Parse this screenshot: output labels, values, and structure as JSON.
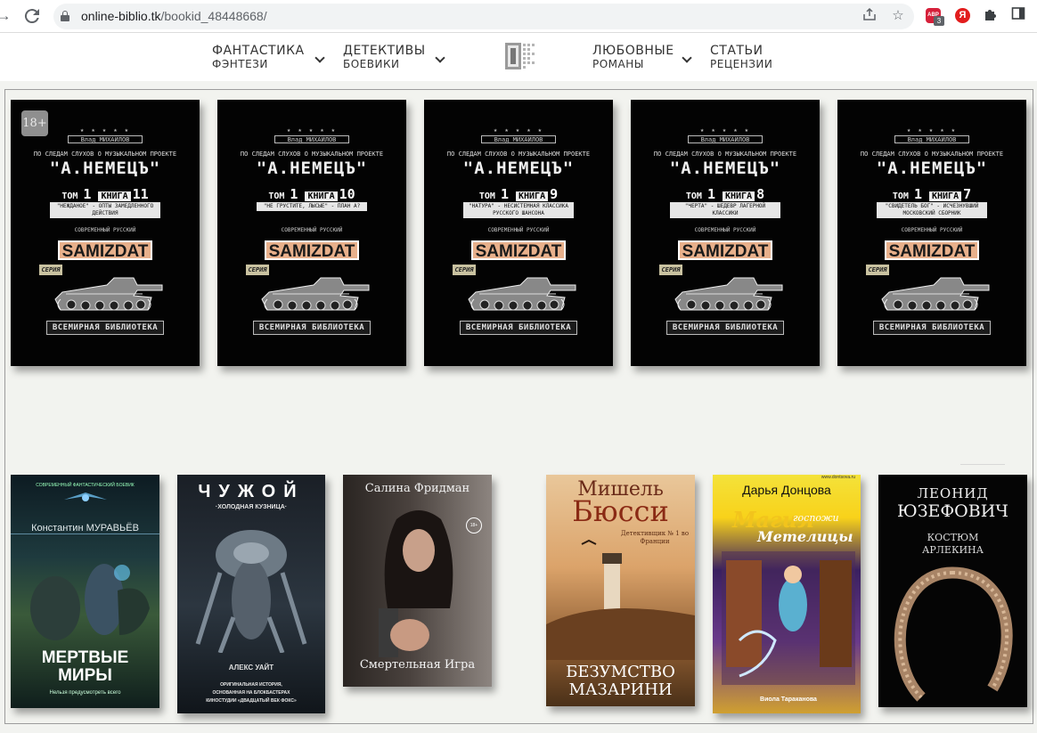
{
  "browser": {
    "back_icon": "arrow-right",
    "reload_icon": "reload",
    "url_host": "online-biblio.tk",
    "url_path": "/bookid_48448668/",
    "ext_abp_label": "ABP",
    "ext_abp_badge": "3",
    "ext_yandex_label": "Я"
  },
  "nav": {
    "items": [
      {
        "line1": "ФАНТАСТИКА",
        "line2": "ФЭНТЕЗИ",
        "has_dropdown": true
      },
      {
        "line1": "ДЕТЕКТИВЫ",
        "line2": "БОЕВИКИ",
        "has_dropdown": true
      },
      {
        "line1": "ЛЮБОВНЫЕ",
        "line2": "РОМАНЫ",
        "has_dropdown": true
      },
      {
        "line1": "СТАТЬИ",
        "line2": "РЕЦЕНЗИИ",
        "has_dropdown": false
      }
    ]
  },
  "series_books": [
    {
      "author": "Влад МИХАЙЛОВ",
      "project": "ПО СЛЕДАМ СЛУХОВ О МУЗЫКАЛЬНОМ ПРОЕКТЕ",
      "title": "\"А.НЕМЕЦЪ\"",
      "tom_word": "ТОМ",
      "tom": "1",
      "kniga_word": "КНИГА",
      "kniga": "11",
      "subtitle": "\"НЕЖДАНОЕ\" - ОПТЫ ЗАМЕДЛЕННОГО ДЕЙСТВИЯ",
      "sovremenny": "СОВРЕМЕННЫЙ РУССКИЙ",
      "logo": "SAMIZDAT",
      "seriya": "СЕРИЯ",
      "library": "ВСЕМИРНАЯ БИБЛИОТЕКА",
      "age": "18+"
    },
    {
      "author": "Влад МИХАЙЛОВ",
      "project": "ПО СЛЕДАМ СЛУХОВ О МУЗЫКАЛЬНОМ ПРОЕКТЕ",
      "title": "\"А.НЕМЕЦЪ\"",
      "tom_word": "ТОМ",
      "tom": "1",
      "kniga_word": "КНИГА",
      "kniga": "10",
      "subtitle": "\"НЕ ГРУСТИТЕ, ЛЫСЫЕ\" - ПЛАН А?",
      "sovremenny": "СОВРЕМЕННЫЙ РУССКИЙ",
      "logo": "SAMIZDAT",
      "seriya": "СЕРИЯ",
      "library": "ВСЕМИРНАЯ БИБЛИОТЕКА"
    },
    {
      "author": "Влад МИХАЙЛОВ",
      "project": "ПО СЛЕДАМ СЛУХОВ О МУЗЫКАЛЬНОМ ПРОЕКТЕ",
      "title": "\"А.НЕМЕЦЪ\"",
      "tom_word": "ТОМ",
      "tom": "1",
      "kniga_word": "КНИГА",
      "kniga": "9",
      "subtitle": "\"НАТУРА\" - НЕСИСТЕМНАЯ КЛАССИКА РУССКОГО ШАНСОНА",
      "sovremenny": "СОВРЕМЕННЫЙ РУССКИЙ",
      "logo": "SAMIZDAT",
      "seriya": "СЕРИЯ",
      "library": "ВСЕМИРНАЯ БИБЛИОТЕКА"
    },
    {
      "author": "Влад МИХАЙЛОВ",
      "project": "ПО СЛЕДАМ СЛУХОВ О МУЗЫКАЛЬНОМ ПРОЕКТЕ",
      "title": "\"А.НЕМЕЦЪ\"",
      "tom_word": "ТОМ",
      "tom": "1",
      "kniga_word": "КНИГА",
      "kniga": "8",
      "subtitle": "\"ЧЕРТА\" - ШЕДЕВР ЛАГЕРНОЙ КЛАССИКИ",
      "sovremenny": "СОВРЕМЕННЫЙ РУССКИЙ",
      "logo": "SAMIZDAT",
      "seriya": "СЕРИЯ",
      "library": "ВСЕМИРНАЯ БИБЛИОТЕКА"
    },
    {
      "author": "Влад МИХАЙЛОВ",
      "project": "ПО СЛЕДАМ СЛУХОВ О МУЗЫКАЛЬНОМ ПРОЕКТЕ",
      "title": "\"А.НЕМЕЦЪ\"",
      "tom_word": "ТОМ",
      "tom": "1",
      "kniga_word": "КНИГА",
      "kniga": "7",
      "subtitle": "\"СВИДЕТЕЛЬ БОГ\" - ИСЧЕЗНУВШИЙ МОСКОВСКИЙ СБОРНИК",
      "sovremenny": "СОВРЕМЕННЫЙ РУССКИЙ",
      "logo": "SAMIZDAT",
      "seriya": "СЕРИЯ",
      "library": "ВСЕМИРНАЯ БИБЛИОТЕКА"
    }
  ],
  "books": [
    {
      "author": "Константин МУРАВЬЁВ",
      "title_line1": "МЕРТВЫЕ",
      "title_line2": "МИРЫ",
      "tagline": "Нельзя предусмотреть всего",
      "top_small": "СОВРЕМЕННЫЙ ФАНТАСТИЧЕСКИЙ БОЕВИК"
    },
    {
      "title": "ЧУЖОЙ",
      "subtitle": "·ХОЛОДНАЯ КУЗНИЦА·",
      "author": "АЛЕКС УАЙТ",
      "desc_line1": "ОРИГИНАЛЬНАЯ ИСТОРИЯ,",
      "desc_line2": "ОСНОВАННАЯ НА БЛОКБАСТЕРАХ",
      "desc_line3": "КИНОСТУДИИ «ДВАДЦАТЫЙ ВЕК ФОКС»"
    },
    {
      "author": "Салина Фридман",
      "title": "Смертельная Игра",
      "age": "18+"
    },
    {
      "author_first": "Мишель",
      "author_last": "Бюсси",
      "series": "Детективщик № 1 во Франции",
      "title_line1": "БЕЗУМСТВО",
      "title_line2": "МАЗАРИНИ"
    },
    {
      "author": "Дарья Донцова",
      "site": "www.dontsova.ru",
      "title_line1": "Магия",
      "title_line2": "госпожи",
      "title_line3": "Метелицы",
      "series": "Иронический детектив",
      "bottom": "Виола Тараканова"
    },
    {
      "author_first": "ЛЕОНИД",
      "author_last": "ЮЗЕФОВИЧ",
      "title_line1": "КОСТЮМ",
      "title_line2": "АРЛЕКИНА"
    }
  ],
  "colors": {
    "accent_samizdat": "#e8b08b",
    "frame_border": "#9c9c9c",
    "page_bg": "#f2f3ef"
  }
}
